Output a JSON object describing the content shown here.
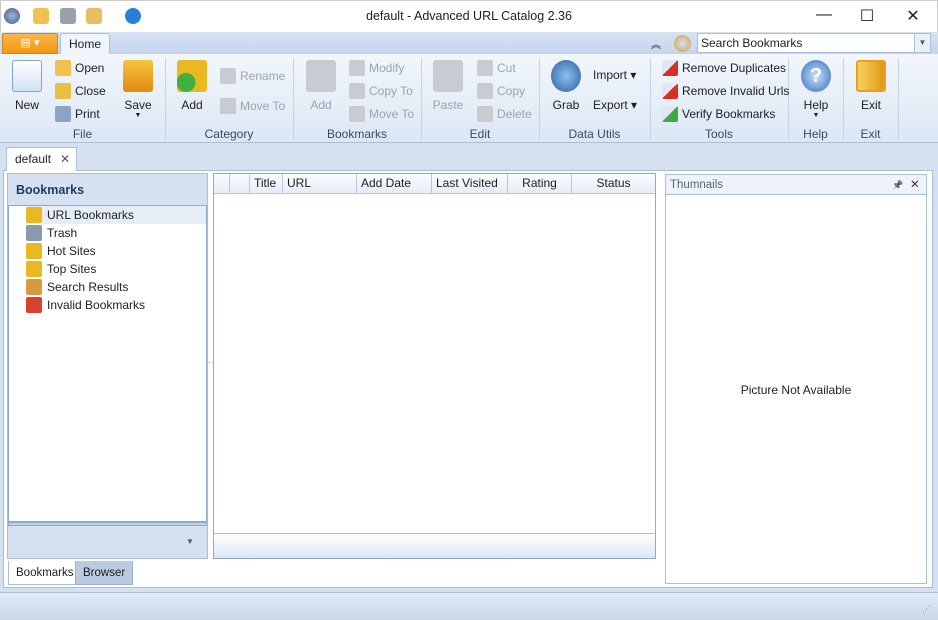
{
  "window": {
    "title": "default - Advanced URL Catalog 2.36",
    "minimize": "—",
    "maximize": "☐",
    "close": "✕"
  },
  "ribbon": {
    "tab_home": "Home",
    "collapse": "︽",
    "search_placeholder": "Search Bookmarks",
    "file": {
      "label": "File",
      "new": "New",
      "open": "Open",
      "close": "Close",
      "print": "Print",
      "save": "Save"
    },
    "category": {
      "label": "Category",
      "add": "Add",
      "rename": "Rename",
      "move_to": "Move To"
    },
    "bookmarks": {
      "label": "Bookmarks",
      "add": "Add",
      "modify": "Modify",
      "copy_to": "Copy To",
      "move_to": "Move To"
    },
    "edit": {
      "label": "Edit",
      "paste": "Paste",
      "cut": "Cut",
      "copy": "Copy",
      "delete": "Delete"
    },
    "data_utils": {
      "label": "Data Utils",
      "grab": "Grab",
      "import": "Import ▾",
      "export": "Export ▾"
    },
    "tools": {
      "label": "Tools",
      "remove_duplicates": "Remove Duplicates",
      "remove_invalid": "Remove Invalid Urls",
      "verify": "Verify Bookmarks"
    },
    "help": {
      "label": "Help",
      "help": "Help"
    },
    "exit": {
      "label": "Exit",
      "exit": "Exit"
    }
  },
  "doc_tab": {
    "label": "default",
    "close": "✕"
  },
  "bookmarks_panel": {
    "title": "Bookmarks",
    "items": [
      {
        "label": "URL Bookmarks",
        "color": "#e8b920"
      },
      {
        "label": "Trash",
        "color": "#8a9aaa"
      },
      {
        "label": "Hot Sites",
        "color": "#e8b920"
      },
      {
        "label": "Top Sites",
        "color": "#e8b920"
      },
      {
        "label": "Search Results",
        "color": "#d89a40"
      },
      {
        "label": "Invalid Bookmarks",
        "color": "#d84030"
      }
    ]
  },
  "grid": {
    "columns": [
      "",
      "",
      "Title",
      "URL",
      "Add Date",
      "Last Visited",
      "Rating",
      "Status"
    ]
  },
  "thumbnails": {
    "title": "Thumnails",
    "pin": "📌",
    "close": "✕",
    "empty": "Picture Not Available"
  },
  "bottom_tabs": {
    "bookmarks": "Bookmarks",
    "browser": "Browser"
  }
}
